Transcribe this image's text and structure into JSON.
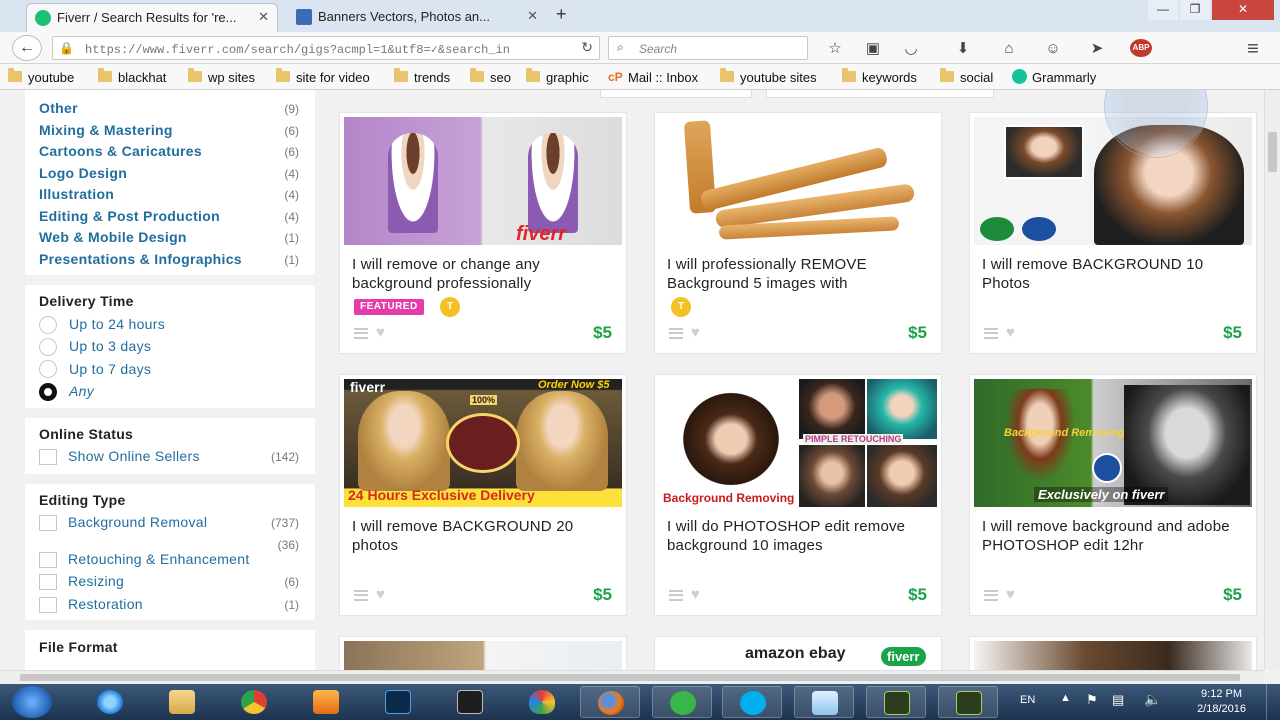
{
  "browser": {
    "tabs": [
      {
        "title": "Fiverr / Search Results for 're...",
        "active": true
      },
      {
        "title": "Banners Vectors, Photos an...",
        "active": false
      }
    ],
    "new_tab_label": "+",
    "url": "https://www.fiverr.com/search/gigs?acmpl=1&utf8=✓&search_in",
    "search_placeholder": "Search",
    "window_controls": [
      "—",
      "❐",
      "✕"
    ]
  },
  "bookmarks": [
    "youtube",
    "blackhat",
    "wp sites",
    "site for video",
    "trends",
    "seo",
    "graphic",
    "Mail :: Inbox",
    "youtube sites",
    "keywords",
    "social",
    "Grammarly"
  ],
  "sidebar": {
    "categories": [
      {
        "label": "Other",
        "count": "(9)"
      },
      {
        "label": "Mixing & Mastering",
        "count": "(6)"
      },
      {
        "label": "Cartoons & Caricatures",
        "count": "(6)"
      },
      {
        "label": "Logo Design",
        "count": "(4)"
      },
      {
        "label": "Illustration",
        "count": "(4)"
      },
      {
        "label": "Editing & Post Production",
        "count": "(4)"
      },
      {
        "label": "Web & Mobile Design",
        "count": "(1)"
      },
      {
        "label": "Presentations & Infographics",
        "count": "(1)"
      }
    ],
    "delivery": {
      "title": "Delivery Time",
      "options": [
        "Up to 24 hours",
        "Up to 3 days",
        "Up to 7 days",
        "Any"
      ],
      "selected": "Any"
    },
    "online": {
      "title": "Online Status",
      "label": "Show Online Sellers",
      "count": "(142)"
    },
    "editing": {
      "title": "Editing Type",
      "options": [
        {
          "label": "Background Removal",
          "count": "(737)"
        },
        {
          "label": "Retouching & Enhancement",
          "count": "(36)"
        },
        {
          "label": "Resizing",
          "count": "(6)"
        },
        {
          "label": "Restoration",
          "count": "(1)"
        }
      ]
    },
    "file_format": {
      "title": "File Format"
    }
  },
  "gigs": [
    {
      "title": "I will remove or change any background professionally",
      "price": "$5",
      "featured": "FEATURED",
      "level": "T",
      "thumb_text": "fiverr"
    },
    {
      "title": "I will professionally REMOVE Background 5 images with",
      "price": "$5",
      "level": "T"
    },
    {
      "title": "I will remove BACKGROUND 10 Photos",
      "price": "$5"
    },
    {
      "title": "I will remove BACKGROUND 20 photos",
      "price": "$5",
      "thumb_text": "24 Hours Exclusive Delivery",
      "thumb_brand": "fiverr",
      "thumb_badge": "Order Now $5",
      "thumb_pct": "100%"
    },
    {
      "title": "I will do PHOTOSHOP edit remove background 10 images",
      "price": "$5",
      "thumb_text": "Background Removing",
      "thumb_text2": "PIMPLE RETOUCHING"
    },
    {
      "title": "I will remove background and adobe PHOTOSHOP edit 12hr",
      "price": "$5",
      "thumb_text": "Exclusively on fiverr",
      "thumb_text2": "Background Removing"
    }
  ],
  "bottom_thumbs": {
    "mid_text": "amazon ebay",
    "mid_brand": "fiverr"
  },
  "taskbar": {
    "lang": "EN",
    "time": "9:12 PM",
    "date": "2/18/2016"
  },
  "colors": {
    "link": "#1f6e9e",
    "price": "#1ba34a",
    "featured": "#e63cab",
    "taskbar": "#2a4463"
  }
}
